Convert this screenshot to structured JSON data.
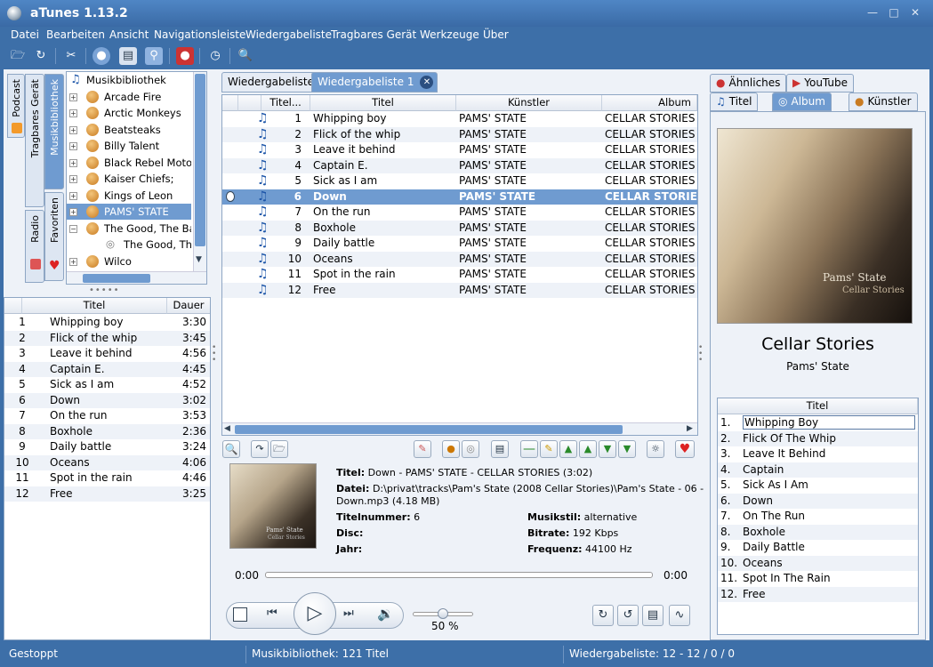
{
  "window": {
    "title": "aTunes 1.13.2"
  },
  "menu": [
    "Datei",
    "Bearbeiten",
    "Ansicht",
    "Navigationsleiste",
    "Wiedergabeliste",
    "Tragbares Gerät",
    "Werkzeuge",
    "Über"
  ],
  "toolbar_icons": [
    "folder-icon",
    "refresh-icon",
    "tools-icon",
    "globe-icon",
    "window-icon",
    "web-icon",
    "record-icon",
    "clock-icon",
    "search-icon"
  ],
  "nav_tabs": {
    "podcast": "Podcast",
    "device": "Tragbares Gerät",
    "library": "Musikbibliothek",
    "radio": "Radio",
    "favorites": "Favoriten"
  },
  "tree": {
    "root": "Musikbibliothek",
    "items": [
      "Arcade Fire",
      "Arctic Monkeys",
      "Beatsteaks",
      "Billy Talent",
      "Black Rebel Motorcycle Club",
      "Kaiser Chiefs;",
      "Kings of Leon",
      "PAMS' STATE",
      "The Good, The Bad & The Queen",
      "Wilco"
    ],
    "child": "The Good, The Bad & The Queen"
  },
  "mini_list": {
    "col_title": "Titel",
    "col_duration": "Dauer",
    "rows": [
      {
        "n": "1",
        "t": "Whipping boy",
        "d": "3:30"
      },
      {
        "n": "2",
        "t": "Flick of the whip",
        "d": "3:45"
      },
      {
        "n": "3",
        "t": "Leave it behind",
        "d": "4:56"
      },
      {
        "n": "4",
        "t": "Captain E.",
        "d": "4:45"
      },
      {
        "n": "5",
        "t": "Sick as I am",
        "d": "4:52"
      },
      {
        "n": "6",
        "t": "Down",
        "d": "3:02"
      },
      {
        "n": "7",
        "t": "On the run",
        "d": "3:53"
      },
      {
        "n": "8",
        "t": "Boxhole",
        "d": "2:36"
      },
      {
        "n": "9",
        "t": "Daily battle",
        "d": "3:24"
      },
      {
        "n": "10",
        "t": "Oceans",
        "d": "4:06"
      },
      {
        "n": "11",
        "t": "Spot in the rain",
        "d": "4:46"
      },
      {
        "n": "12",
        "t": "Free",
        "d": "3:25"
      }
    ]
  },
  "playlist_tabs": [
    "Wiedergabeliste",
    "Wiedergabeliste 1"
  ],
  "playlist": {
    "headers": [
      "Titel...",
      "Titel",
      "Künstler",
      "Album"
    ],
    "rows": [
      {
        "n": "1",
        "t": "Whipping boy",
        "a": "PAMS' STATE",
        "al": "CELLAR STORIES"
      },
      {
        "n": "2",
        "t": "Flick of the whip",
        "a": "PAMS' STATE",
        "al": "CELLAR STORIES"
      },
      {
        "n": "3",
        "t": "Leave it behind",
        "a": "PAMS' STATE",
        "al": "CELLAR STORIES"
      },
      {
        "n": "4",
        "t": "Captain E.",
        "a": "PAMS' STATE",
        "al": "CELLAR STORIES"
      },
      {
        "n": "5",
        "t": "Sick as I am",
        "a": "PAMS' STATE",
        "al": "CELLAR STORIES"
      },
      {
        "n": "6",
        "t": "Down",
        "a": "PAMS' STATE",
        "al": "CELLAR STORIES"
      },
      {
        "n": "7",
        "t": "On the run",
        "a": "PAMS' STATE",
        "al": "CELLAR STORIES"
      },
      {
        "n": "8",
        "t": "Boxhole",
        "a": "PAMS' STATE",
        "al": "CELLAR STORIES"
      },
      {
        "n": "9",
        "t": "Daily battle",
        "a": "PAMS' STATE",
        "al": "CELLAR STORIES"
      },
      {
        "n": "10",
        "t": "Oceans",
        "a": "PAMS' STATE",
        "al": "CELLAR STORIES"
      },
      {
        "n": "11",
        "t": "Spot in the rain",
        "a": "PAMS' STATE",
        "al": "CELLAR STORIES"
      },
      {
        "n": "12",
        "t": "Free",
        "a": "PAMS' STATE",
        "al": "CELLAR STORIES"
      }
    ],
    "selected_index": 5
  },
  "now_playing": {
    "title_label": "Titel:",
    "title_value": "Down - PAMS' STATE - CELLAR STORIES (3:02)",
    "file_label": "Datei:",
    "file_value": "D:\\privat\\tracks\\Pam's State (2008 Cellar Stories)\\Pam's State - 06 -",
    "file_value2": "Down.mp3 (4.18 MB)",
    "track_label": "Titelnummer:",
    "track_value": "6",
    "disc_label": "Disc:",
    "year_label": "Jahr:",
    "genre_label": "Musikstil:",
    "genre_value": "alternative",
    "bitrate_label": "Bitrate:",
    "bitrate_value": "192 Kbps",
    "freq_label": "Frequenz:",
    "freq_value": "44100 Hz",
    "cover_text_1": "Pams' State",
    "cover_text_2": "Cellar Stories"
  },
  "progress": {
    "elapsed": "0:00",
    "remaining": "0:00",
    "fraction": 0.0
  },
  "volume": {
    "label": "50 %",
    "fraction": 0.5
  },
  "context_tabs": {
    "similar": "Ähnliches",
    "youtube": "YouTube",
    "title": "Titel",
    "album": "Album",
    "artist": "Künstler"
  },
  "album": {
    "name": "Cellar Stories",
    "artist": "Pams' State",
    "cover_text_1": "Pams' State",
    "cover_text_2": "Cellar Stories",
    "col_title": "Titel",
    "tracks": [
      "Whipping Boy",
      "Flick Of The Whip",
      "Leave It Behind",
      "Captain",
      "Sick As I Am",
      "Down",
      "On The Run",
      "Boxhole",
      "Daily Battle",
      "Oceans",
      "Spot In The Rain",
      "Free"
    ],
    "numbers": [
      "1.",
      "2.",
      "3.",
      "4.",
      "5.",
      "6.",
      "7.",
      "8.",
      "9.",
      "10.",
      "11.",
      "12."
    ]
  },
  "status": {
    "state": "Gestoppt",
    "library": "Musikbibliothek: 121 Titel",
    "playlist": "Wiedergabeliste: 12 - 12 / 0 / 0"
  },
  "colors": {
    "frame": "#3d6fa8",
    "selection": "#6f9bd0",
    "panel": "#eef2f8"
  }
}
